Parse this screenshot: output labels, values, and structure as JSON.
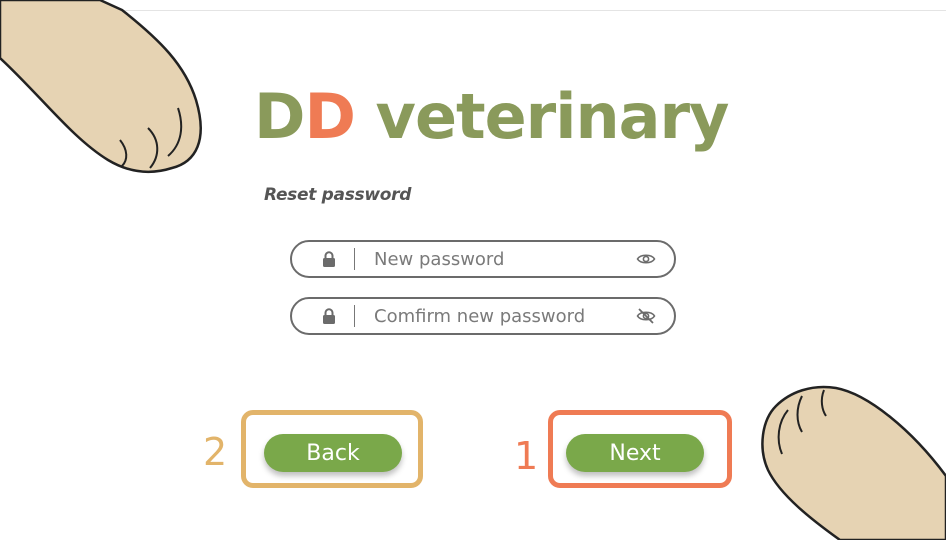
{
  "app": {
    "logo_d1": "D",
    "logo_d2": "D",
    "logo_rest": " veterinary"
  },
  "page": {
    "subtitle": "Reset password"
  },
  "form": {
    "new_password": {
      "value": "",
      "placeholder": "New password",
      "visibility_icon": "eye-icon"
    },
    "confirm_password": {
      "value": "",
      "placeholder": "Comfirm new password",
      "visibility_icon": "eye-off-icon"
    },
    "field_icon": "lock-icon"
  },
  "actions": {
    "back_label": "Back",
    "next_label": "Next",
    "back_step": "2",
    "next_step": "1"
  },
  "colors": {
    "logo_green": "#8a9a5b",
    "logo_accent": "#ef7b54",
    "button_green": "#7aa84a",
    "highlight_orange": "#ef7b54",
    "highlight_yellow": "#e2b46a",
    "paw_fill": "#e6d3b3"
  }
}
